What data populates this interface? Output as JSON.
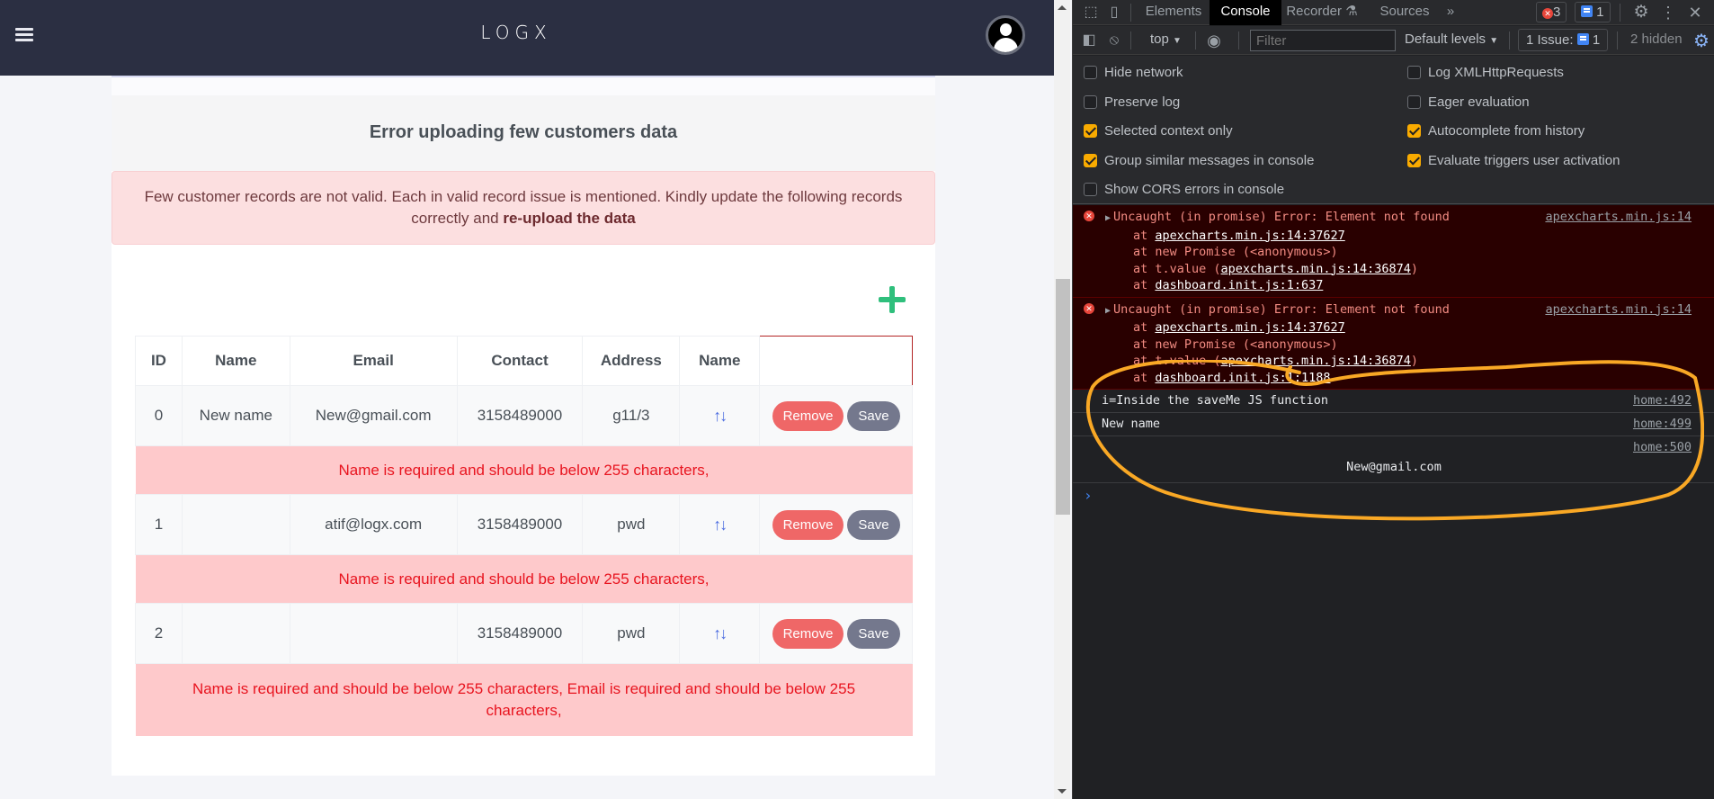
{
  "navbar": {
    "brand": "LOGX",
    "menu_icon": "hamburger-icon",
    "avatar_icon": "user-avatar-icon"
  },
  "card": {
    "title": "Error uploading few customers data",
    "alert_text": "Few customer records are not valid. Each in valid record issue is mentioned. Kindly update the following records correctly and ",
    "alert_bold": "re-upload the data",
    "add_icon": "plus-icon"
  },
  "table": {
    "headers": [
      "ID",
      "Name",
      "Email",
      "Contact",
      "Address",
      "Name",
      ""
    ],
    "sort_icon": "↑↓",
    "remove_label": "Remove",
    "save_label": "Save",
    "rows": [
      {
        "id": "0",
        "name": "New name",
        "email": "New@gmail.com",
        "contact": "3158489000",
        "address": "g11/3",
        "error": "Name is required and should be below 255 characters,"
      },
      {
        "id": "1",
        "name": "",
        "email": "atif@logx.com",
        "contact": "3158489000",
        "address": "pwd",
        "error": "Name is required and should be below 255 characters,"
      },
      {
        "id": "2",
        "name": "",
        "email": "",
        "contact": "3158489000",
        "address": "pwd",
        "error": "Name is required and should be below 255 characters, Email is required and should be below 255 characters,"
      }
    ]
  },
  "colors": {
    "navbar_bg": "#2b2f42",
    "alert_bg": "#fcdfe0",
    "row_error_bg": "#fec9cb",
    "row_error_text": "#e8141f",
    "remove_btn": "#ef6767",
    "save_btn": "#74788d",
    "add_icon": "#2fbf7c",
    "sort_icon": "#4c6ce0",
    "annotation": "#f9a825"
  },
  "devtools": {
    "tabs": [
      "Elements",
      "Console",
      "Recorder",
      "Sources"
    ],
    "active_tab": "Console",
    "more_tabs": "»",
    "error_count": "3",
    "message_count": "1",
    "toolbar": {
      "context": "top",
      "filter_placeholder": "Filter",
      "levels": "Default levels",
      "issues_label": "1 Issue:",
      "issues_count": "1",
      "hidden": "2 hidden"
    },
    "settings": {
      "left": [
        {
          "label": "Hide network",
          "checked": false
        },
        {
          "label": "Preserve log",
          "checked": false
        },
        {
          "label": "Selected context only",
          "checked": true
        },
        {
          "label": "Group similar messages in console",
          "checked": true
        },
        {
          "label": "Show CORS errors in console",
          "checked": false
        }
      ],
      "right": [
        {
          "label": "Log XMLHttpRequests",
          "checked": false
        },
        {
          "label": "Eager evaluation",
          "checked": false
        },
        {
          "label": "Autocomplete from history",
          "checked": true
        },
        {
          "label": "Evaluate triggers user activation",
          "checked": true
        }
      ]
    },
    "console": {
      "errors": [
        {
          "message": "Uncaught (in promise) Error: Element not found",
          "source": "apexcharts.min.js:14",
          "frame1_link": "apexcharts.min.js:14:37627",
          "frame2": "at new Promise (<anonymous>)",
          "frame3_link": "apexcharts.min.js:14:36874",
          "frame4_link": "dashboard.init.js:1:637"
        },
        {
          "message": "Uncaught (in promise) Error: Element not found",
          "source": "apexcharts.min.js:14",
          "frame1_link": "apexcharts.min.js:14:37627",
          "frame2": "at new Promise (<anonymous>)",
          "frame3_link": "apexcharts.min.js:14:36874",
          "frame4_link": "dashboard.init.js:1:1188"
        }
      ],
      "logs": [
        {
          "text": "i=Inside the saveMe JS function",
          "source": "home:492"
        },
        {
          "text": "New name",
          "source": "home:499"
        },
        {
          "text": "New@gmail.com",
          "source": "home:500"
        }
      ],
      "at_label": "at",
      "tvalue_label": "at t.value (",
      "close_paren": ")"
    }
  }
}
